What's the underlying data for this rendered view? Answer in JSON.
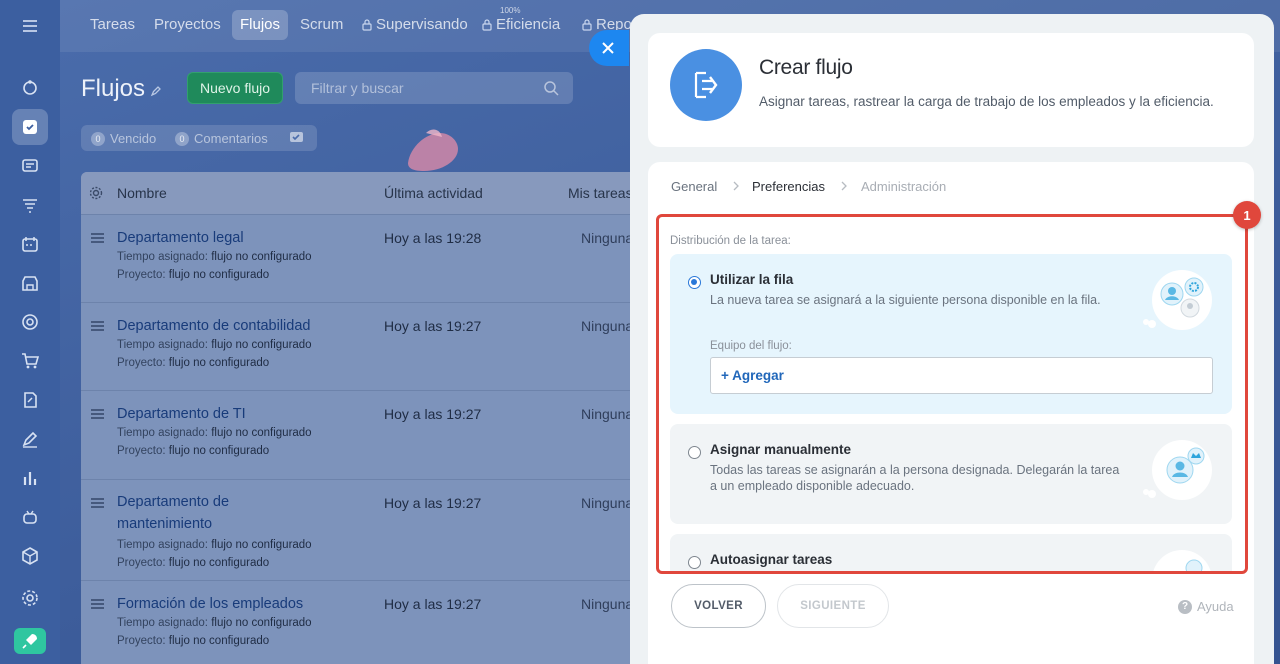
{
  "topnav": {
    "items": [
      "Tareas",
      "Proyectos",
      "Flujos",
      "Scrum",
      "Supervisando",
      "Eficiencia",
      "Repo"
    ],
    "efficiency_value": "100%"
  },
  "page": {
    "title": "Flujos",
    "new_button": "Nuevo flujo",
    "search_placeholder": "Filtrar y buscar"
  },
  "counters": {
    "overdue_count": "0",
    "overdue_label": "Vencido",
    "comments_count": "0",
    "comments_label": "Comentarios"
  },
  "table": {
    "headers": [
      "Nombre",
      "Última actividad",
      "Mis tareas"
    ],
    "assigned_label": "Tiempo asignado:",
    "project_label": "Proyecto:",
    "rows": [
      {
        "name": "Departamento legal",
        "time": "flujo no configurado",
        "project": "flujo no configurado",
        "activity": "Hoy a las 19:28",
        "mine": "Ninguna"
      },
      {
        "name": "Departamento de contabilidad",
        "time": "flujo no configurado",
        "project": "flujo no configurado",
        "activity": "Hoy a las 19:27",
        "mine": "Ninguna"
      },
      {
        "name": "Departamento de TI",
        "time": "flujo no configurado",
        "project": "flujo no configurado",
        "activity": "Hoy a las 19:27",
        "mine": "Ninguna"
      },
      {
        "name": "Departamento de mantenimiento",
        "time": "flujo no configurado",
        "project": "flujo no configurado",
        "activity": "Hoy a las 19:27",
        "mine": "Ninguna"
      },
      {
        "name": "Formación de los empleados",
        "time": "flujo no configurado",
        "project": "flujo no configurado",
        "activity": "Hoy a las 19:27",
        "mine": "Ninguna"
      }
    ]
  },
  "slider": {
    "title": "Crear flujo",
    "subtitle": "Asignar tareas, rastrear la carga de trabajo de los empleados y la eficiencia.",
    "steps": [
      "General",
      "Preferencias",
      "Administración"
    ],
    "distribution_label": "Distribución de la tarea:",
    "options": [
      {
        "title": "Utilizar la fila",
        "desc": "La nueva tarea se asignará a la siguiente persona disponible en la fila.",
        "selected": true
      },
      {
        "title": "Asignar manualmente",
        "desc": "Todas las tareas se asignarán a la persona designada. Delegarán la tarea a un empleado disponible adecuado.",
        "selected": false
      },
      {
        "title": "Autoasignar tareas",
        "desc": "",
        "selected": false
      }
    ],
    "team_label": "Equipo del flujo:",
    "add_label": "+ Agregar",
    "back_button": "VOLVER",
    "next_button": "SIGUIENTE",
    "help_label": "Ayuda"
  },
  "annotation": {
    "badge": "1",
    "color": "#e0473c"
  },
  "colors": {
    "accent": "#1d87f0",
    "new_button": "#1f8a5b",
    "link": "#2167ba"
  }
}
